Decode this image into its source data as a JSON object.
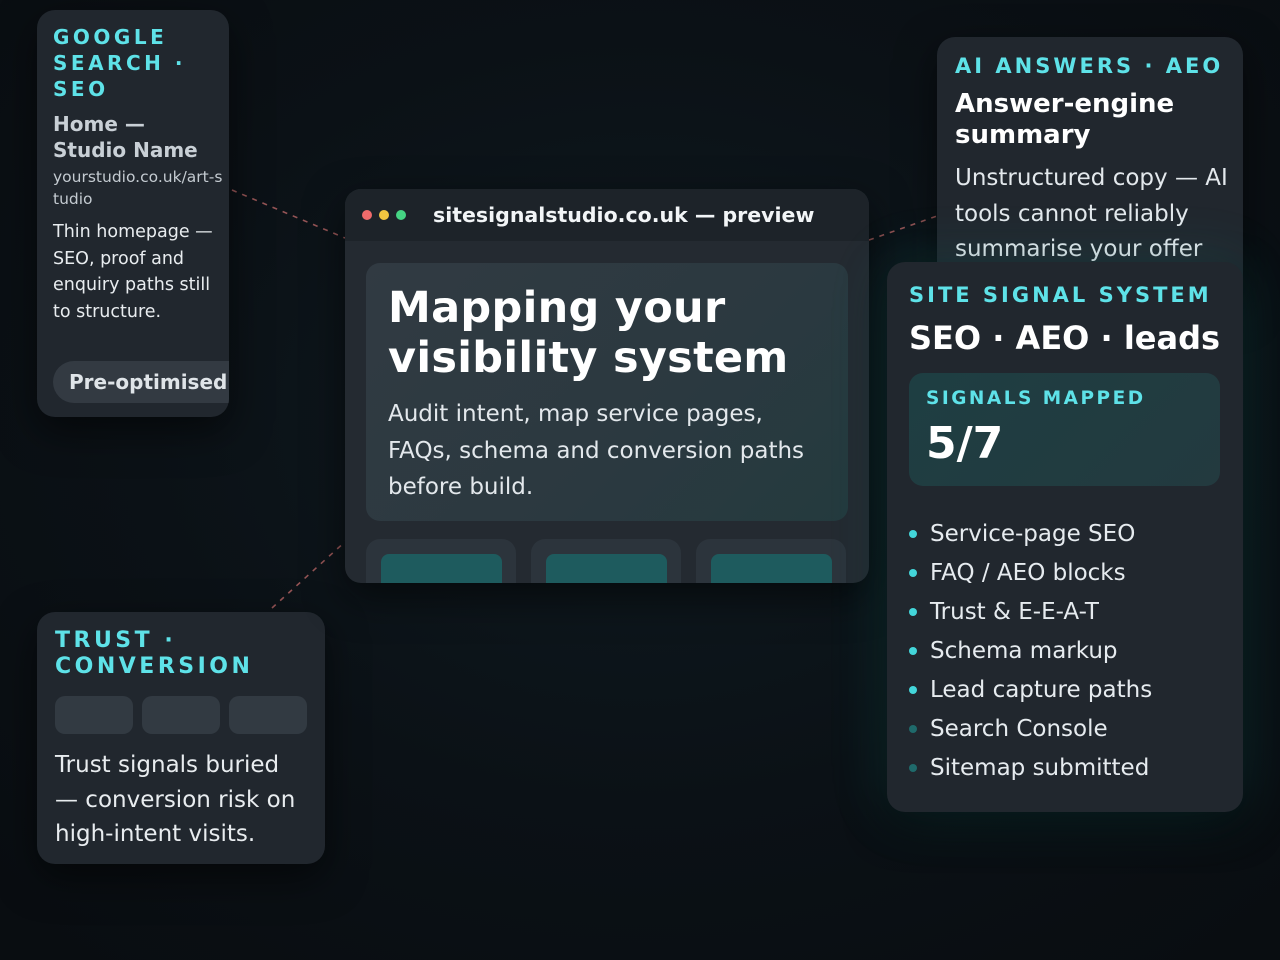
{
  "colors": {
    "accent": "#5ee2e8",
    "background": "#0b1116",
    "card": "#21272e",
    "dot_red": "#f06b6b",
    "dot_yellow": "#f2c640",
    "dot_green": "#45d483",
    "connector": "#c46b6b"
  },
  "seo_card": {
    "eyebrow": "GOOGLE SEARCH · SEO",
    "serp_title": "Home — Studio Name",
    "serp_url": "yourstudio.co.uk/art-studio",
    "serp_description": "Thin homepage — SEO, proof and enquiry paths still to structure.",
    "status_pill": "Pre-optimised"
  },
  "trust_card": {
    "eyebrow": "TRUST · CONVERSION",
    "description": "Trust signals buried — conversion risk on high-intent visits."
  },
  "browser": {
    "url": "sitesignalstudio.co.uk — preview",
    "hero_title": "Mapping your visibility system",
    "hero_subtitle": "Audit intent, map service pages, FAQs, schema and conversion paths before build."
  },
  "ai_card": {
    "eyebrow": "AI ANSWERS · AEO",
    "title": "Answer-engine summary",
    "description": "Unstructured copy — AI tools cannot reliably summarise your offer"
  },
  "system_card": {
    "eyebrow": "SITE SIGNAL SYSTEM",
    "title": "SEO · AEO · leads",
    "metric_label": "SIGNALS MAPPED",
    "metric_value": "5/7",
    "signals": [
      {
        "label": "Service-page SEO",
        "state": "mapped"
      },
      {
        "label": "FAQ / AEO blocks",
        "state": "mapped"
      },
      {
        "label": "Trust & E-E-A-T",
        "state": "mapped"
      },
      {
        "label": "Schema markup",
        "state": "mapped"
      },
      {
        "label": "Lead capture paths",
        "state": "mapped"
      },
      {
        "label": "Search Console",
        "state": "pending"
      },
      {
        "label": "Sitemap submitted",
        "state": "pending"
      }
    ]
  }
}
